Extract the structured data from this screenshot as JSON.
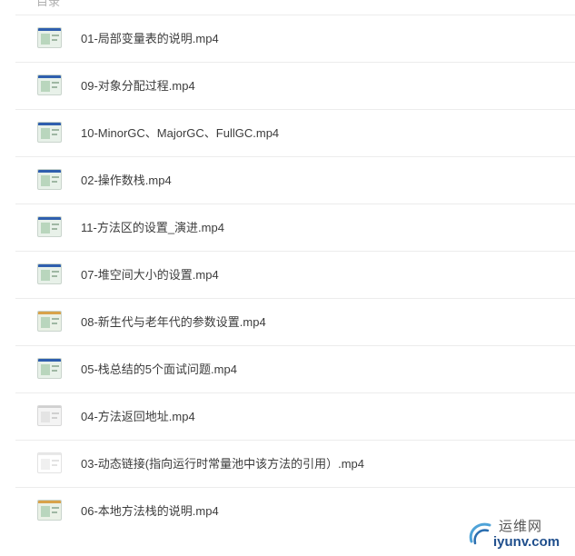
{
  "header": {
    "partial_label": "目录"
  },
  "files": [
    {
      "name": "01-局部变量表的说明.mp4",
      "thumb": "green"
    },
    {
      "name": "09-对象分配过程.mp4",
      "thumb": "green"
    },
    {
      "name": "10-MinorGC、MajorGC、FullGC.mp4",
      "thumb": "green"
    },
    {
      "name": "02-操作数栈.mp4",
      "thumb": "green"
    },
    {
      "name": "11-方法区的设置_演进.mp4",
      "thumb": "green"
    },
    {
      "name": "07-堆空间大小的设置.mp4",
      "thumb": "green"
    },
    {
      "name": "08-新生代与老年代的参数设置.mp4",
      "thumb": "warm"
    },
    {
      "name": "05-栈总结的5个面试问题.mp4",
      "thumb": "green"
    },
    {
      "name": "04-方法返回地址.mp4",
      "thumb": "light"
    },
    {
      "name": "03-动态链接(指向运行时常量池中该方法的引用）.mp4",
      "thumb": "white"
    },
    {
      "name": "06-本地方法栈的说明.mp4",
      "thumb": "warm"
    }
  ],
  "watermark": {
    "text_cn": "运维网",
    "text_domain": "iyunv.com"
  }
}
